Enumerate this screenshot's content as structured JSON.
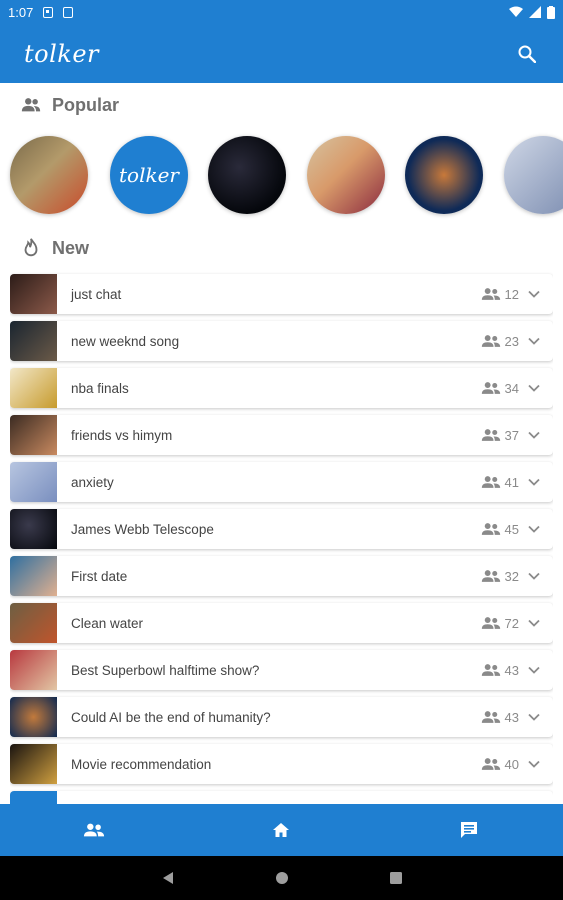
{
  "status_bar": {
    "time": "1:07"
  },
  "app": {
    "logo": "tolker",
    "search_icon": "search-icon"
  },
  "popular": {
    "label": "Popular",
    "icon": "people-icon",
    "stories": [
      {
        "name": "story-clean-water",
        "color_a": "#7a6a4a",
        "color_b": "#c94a2a"
      },
      {
        "name": "story-tolker",
        "logo": "tolker"
      },
      {
        "name": "story-space",
        "color_a": "#05070c",
        "color_b": "#2a2a3a"
      },
      {
        "name": "story-superbowl",
        "color_a": "#d6c3a0",
        "color_b": "#8b2a3f"
      },
      {
        "name": "story-ai",
        "color_a": "#0f2a57",
        "color_b": "#c8793a"
      },
      {
        "name": "story-anxiety",
        "color_a": "#cfd7e6",
        "color_b": "#7b8cb0"
      }
    ]
  },
  "new": {
    "label": "New",
    "icon": "fire-icon",
    "rows": [
      {
        "title": "just chat",
        "count": "12",
        "thumb_a": "#2c1c18",
        "thumb_b": "#8c5a4a"
      },
      {
        "title": "new weeknd song",
        "count": "23",
        "thumb_a": "#1a2530",
        "thumb_b": "#6b5a48"
      },
      {
        "title": "nba finals",
        "count": "34",
        "thumb_a": "#f2e7c8",
        "thumb_b": "#c79b2d"
      },
      {
        "title": "friends vs himym",
        "count": "37",
        "thumb_a": "#3b2b22",
        "thumb_b": "#c98a60"
      },
      {
        "title": "anxiety",
        "count": "41",
        "thumb_a": "#b7c5e0",
        "thumb_b": "#7a8fbf"
      },
      {
        "title": "James Webb Telescope",
        "count": "45",
        "thumb_a": "#05070c",
        "thumb_b": "#3a3a4c"
      },
      {
        "title": "First date",
        "count": "32",
        "thumb_a": "#2f6fa0",
        "thumb_b": "#e0b090"
      },
      {
        "title": "Clean water",
        "count": "72",
        "thumb_a": "#6d5f43",
        "thumb_b": "#c0552c"
      },
      {
        "title": "Best Superbowl halftime show?",
        "count": "43",
        "thumb_a": "#b8393f",
        "thumb_b": "#e2c6a4"
      },
      {
        "title": "Could AI be the end of humanity?",
        "count": "43",
        "thumb_a": "#0e2850",
        "thumb_b": "#c27a3c"
      },
      {
        "title": "Movie recommendation",
        "count": "40",
        "thumb_a": "#1a1410",
        "thumb_b": "#d0a040"
      },
      {
        "title": "",
        "count": "",
        "thumb_a": "#1f7fd1",
        "thumb_b": "#1f7fd1"
      }
    ]
  },
  "bottom_nav": [
    {
      "name": "nav-people",
      "icon": "people-icon"
    },
    {
      "name": "nav-home",
      "icon": "home-icon"
    },
    {
      "name": "nav-chat",
      "icon": "chat-icon"
    }
  ],
  "colors": {
    "primary": "#1f7fd1",
    "muted": "#707070"
  }
}
